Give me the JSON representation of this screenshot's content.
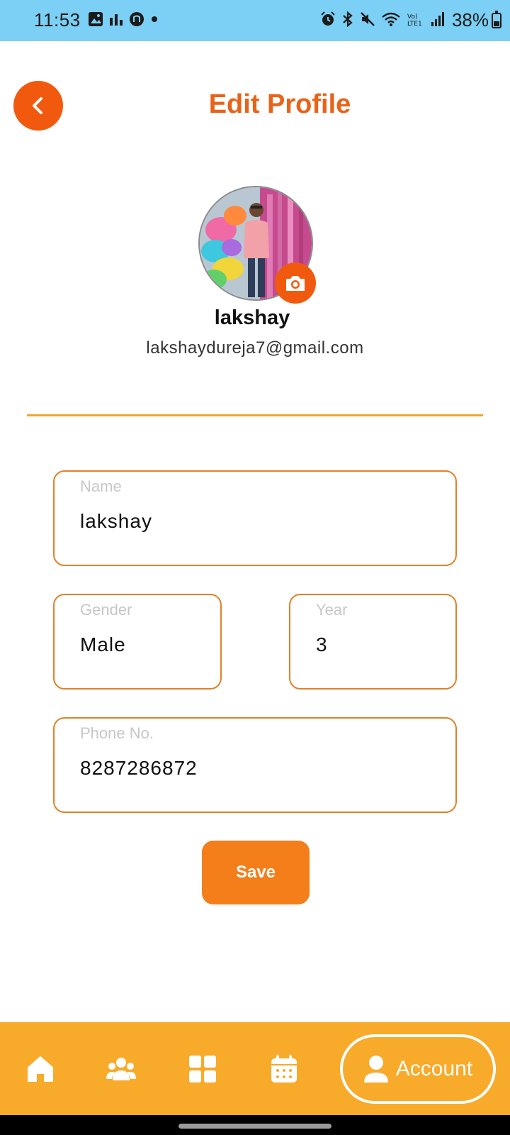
{
  "status_bar": {
    "time": "11:53",
    "battery_text": "38%",
    "battery_level": 0.38,
    "left_icons": [
      "gallery-icon",
      "chart-icon",
      "app-icon",
      "dot-icon"
    ],
    "right_icons": [
      "alarm-icon",
      "bluetooth-icon",
      "mute-icon",
      "wifi-icon",
      "volte-icon",
      "signal-icon"
    ]
  },
  "header": {
    "title": "Edit Profile",
    "back_icon": "chevron-left-icon"
  },
  "profile": {
    "name": "lakshay",
    "email": "lakshaydureja7@gmail.com",
    "camera_icon": "camera-icon"
  },
  "form": {
    "name": {
      "label": "Name",
      "value": "lakshay"
    },
    "gender": {
      "label": "Gender",
      "value": "Male"
    },
    "year": {
      "label": "Year",
      "value": "3"
    },
    "phone": {
      "label": "Phone No.",
      "value": "8287286872"
    },
    "save_label": "Save"
  },
  "bottom_nav": {
    "items": [
      {
        "icon": "home-icon"
      },
      {
        "icon": "people-icon"
      },
      {
        "icon": "grid-icon"
      },
      {
        "icon": "calendar-icon"
      }
    ],
    "account_label": "Account",
    "account_icon": "user-icon"
  },
  "colors": {
    "accent": "#f15a0e",
    "title": "#e86318",
    "nav_bg": "#f8aa2a",
    "status_bg": "#7ccff5",
    "field_border": "#e0812a",
    "save_bg": "#f37e1a"
  }
}
